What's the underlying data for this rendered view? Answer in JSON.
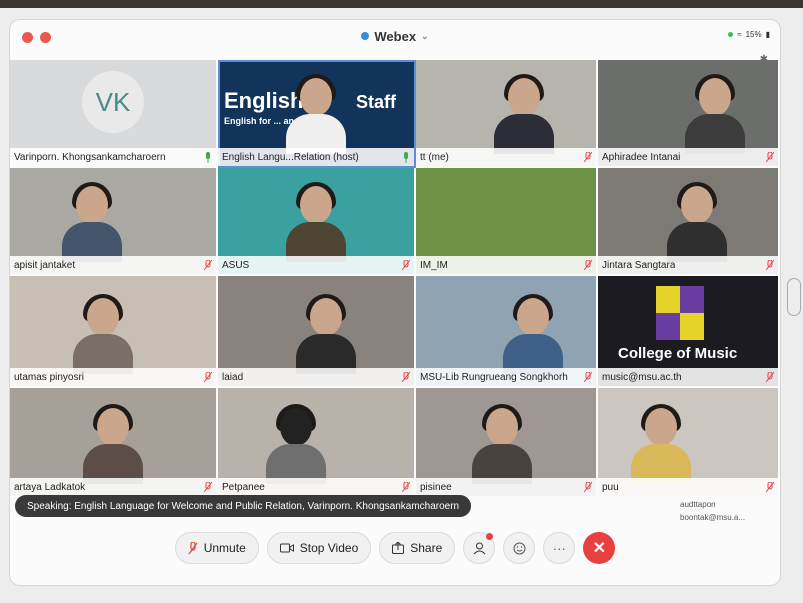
{
  "app": {
    "title": "Webex",
    "battery": "15%"
  },
  "tiles": [
    {
      "name": "Varinporn. Khongsankamcharoern",
      "initials": "VK",
      "muted": false
    },
    {
      "name": "English Langu...Relation (host)",
      "muted": false,
      "active": true,
      "banner_line1": "English",
      "banner_line2": "Staff",
      "banner_line3": "English for ... and Public"
    },
    {
      "name": "tt (me)",
      "muted": true
    },
    {
      "name": "Aphiradee Intanai",
      "muted": true
    },
    {
      "name": "apisit jantaket",
      "muted": true
    },
    {
      "name": "ASUS",
      "muted": true
    },
    {
      "name": "IM_IM",
      "muted": true
    },
    {
      "name": "Jintara Sangtara",
      "muted": true
    },
    {
      "name": "utamas pinyosri",
      "muted": true
    },
    {
      "name": "laiad",
      "muted": true
    },
    {
      "name": "MSU-Lib Rungrueang Songkhorh",
      "muted": true
    },
    {
      "name": "music@msu.ac.th",
      "muted": true,
      "overlay": "College of Music"
    },
    {
      "name": "artaya Ladkatok",
      "muted": true
    },
    {
      "name": "Petpanee",
      "muted": true
    },
    {
      "name": "pisinee",
      "muted": true
    },
    {
      "name": "puu",
      "muted": true
    }
  ],
  "speaking": "Speaking: English Language for Welcome and Public Relation, Varinporn. Khongsankamcharoern",
  "controls": {
    "unmute": "Unmute",
    "stop_video": "Stop Video",
    "share": "Share"
  },
  "camera_tag": {
    "line1": "audttapon",
    "line2": "boontak@msu.a..."
  },
  "colors": {
    "mic_on": "#3fae49",
    "mic_off": "#e8403f",
    "end_call": "#e8403f",
    "highlight": "#5d8fd9"
  }
}
